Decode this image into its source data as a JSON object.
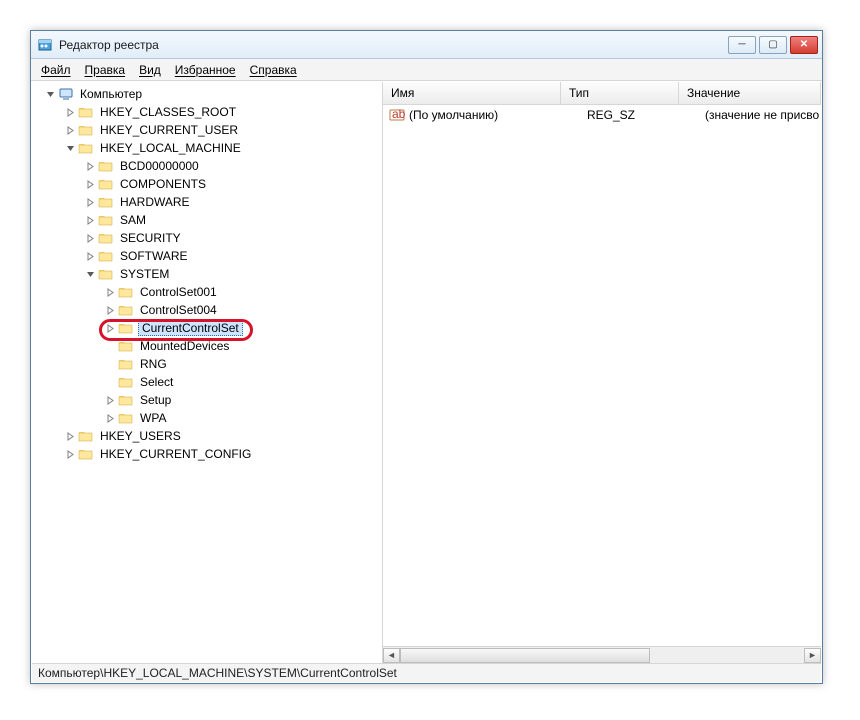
{
  "window": {
    "title": "Редактор реестра"
  },
  "menu": {
    "file": "Файл",
    "edit": "Правка",
    "view": "Вид",
    "favorites": "Избранное",
    "help": "Справка"
  },
  "tree": {
    "root": "Компьютер",
    "hkcr": "HKEY_CLASSES_ROOT",
    "hkcu": "HKEY_CURRENT_USER",
    "hklm": "HKEY_LOCAL_MACHINE",
    "hklm_children": {
      "bcd": "BCD00000000",
      "components": "COMPONENTS",
      "hardware": "HARDWARE",
      "sam": "SAM",
      "security": "SECURITY",
      "software": "SOFTWARE",
      "system": "SYSTEM"
    },
    "system_children": {
      "cs001": "ControlSet001",
      "cs004": "ControlSet004",
      "ccs": "CurrentControlSet",
      "mounted": "MountedDevices",
      "rng": "RNG",
      "select": "Select",
      "setup": "Setup",
      "wpa": "WPA"
    },
    "hku": "HKEY_USERS",
    "hkcc": "HKEY_CURRENT_CONFIG"
  },
  "list": {
    "cols": {
      "name": "Имя",
      "type": "Тип",
      "value": "Значение"
    },
    "rows": [
      {
        "name": "(По умолчанию)",
        "type": "REG_SZ",
        "value": "(значение не присво"
      }
    ]
  },
  "status": "Компьютер\\HKEY_LOCAL_MACHINE\\SYSTEM\\CurrentControlSet"
}
